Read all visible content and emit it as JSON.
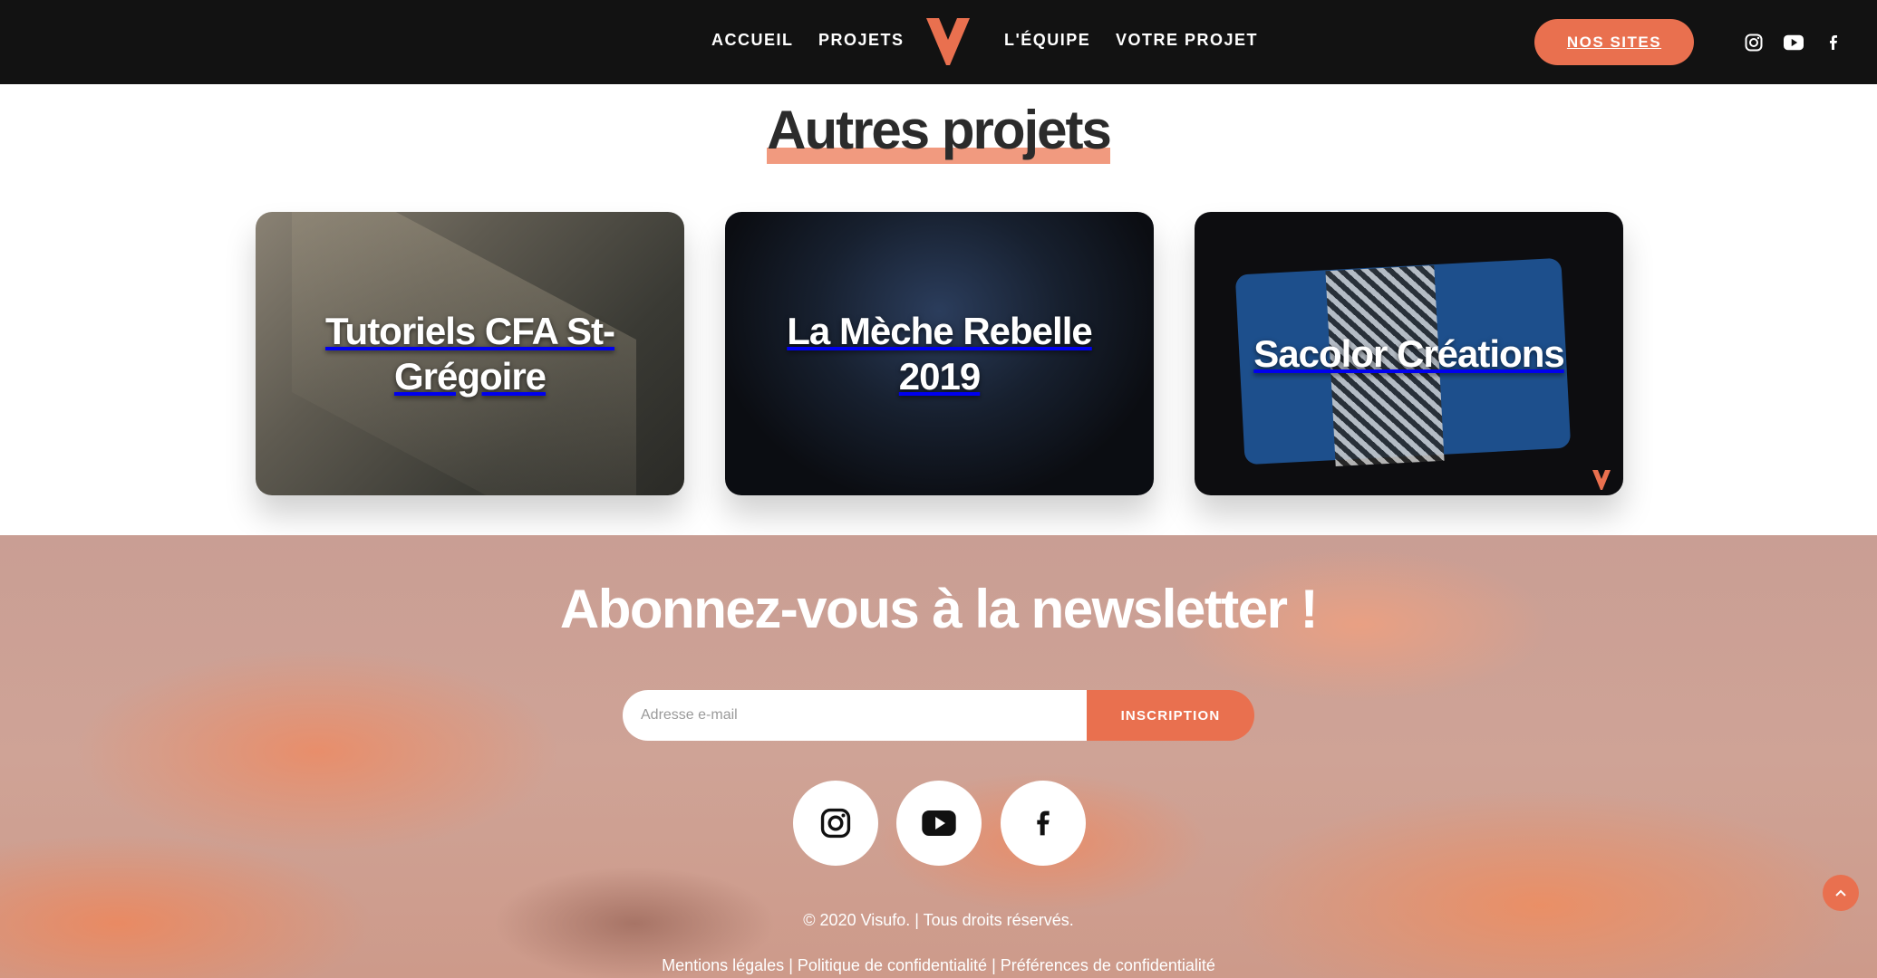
{
  "header": {
    "nav": [
      "ACCUEIL",
      "PROJETS",
      "L'ÉQUIPE",
      "VOTRE PROJET"
    ],
    "cta_label": "NOS SITES",
    "social_icons": [
      "instagram-icon",
      "youtube-icon",
      "facebook-icon"
    ]
  },
  "projects": {
    "title": "Autres projets",
    "cards": [
      {
        "title": "Tutoriels CFA St-Grégoire"
      },
      {
        "title": "La Mèche Rebelle 2019"
      },
      {
        "title": "Sacolor Créations"
      }
    ]
  },
  "newsletter": {
    "title": "Abonnez-vous à la newsletter !",
    "email_placeholder": "Adresse e-mail",
    "submit_label": "INSCRIPTION",
    "social_icons": [
      "instagram-icon",
      "youtube-icon",
      "facebook-icon"
    ]
  },
  "footer": {
    "copyright": "© 2020 Visufo. | Tous droits réservés.",
    "links": [
      "Mentions légales",
      "Politique de confidentialité",
      "Préférences de confidentialité"
    ],
    "separator": "|"
  },
  "colors": {
    "accent": "#e9704f",
    "header_bg": "#121212",
    "title_highlight": "#f19a7f"
  }
}
